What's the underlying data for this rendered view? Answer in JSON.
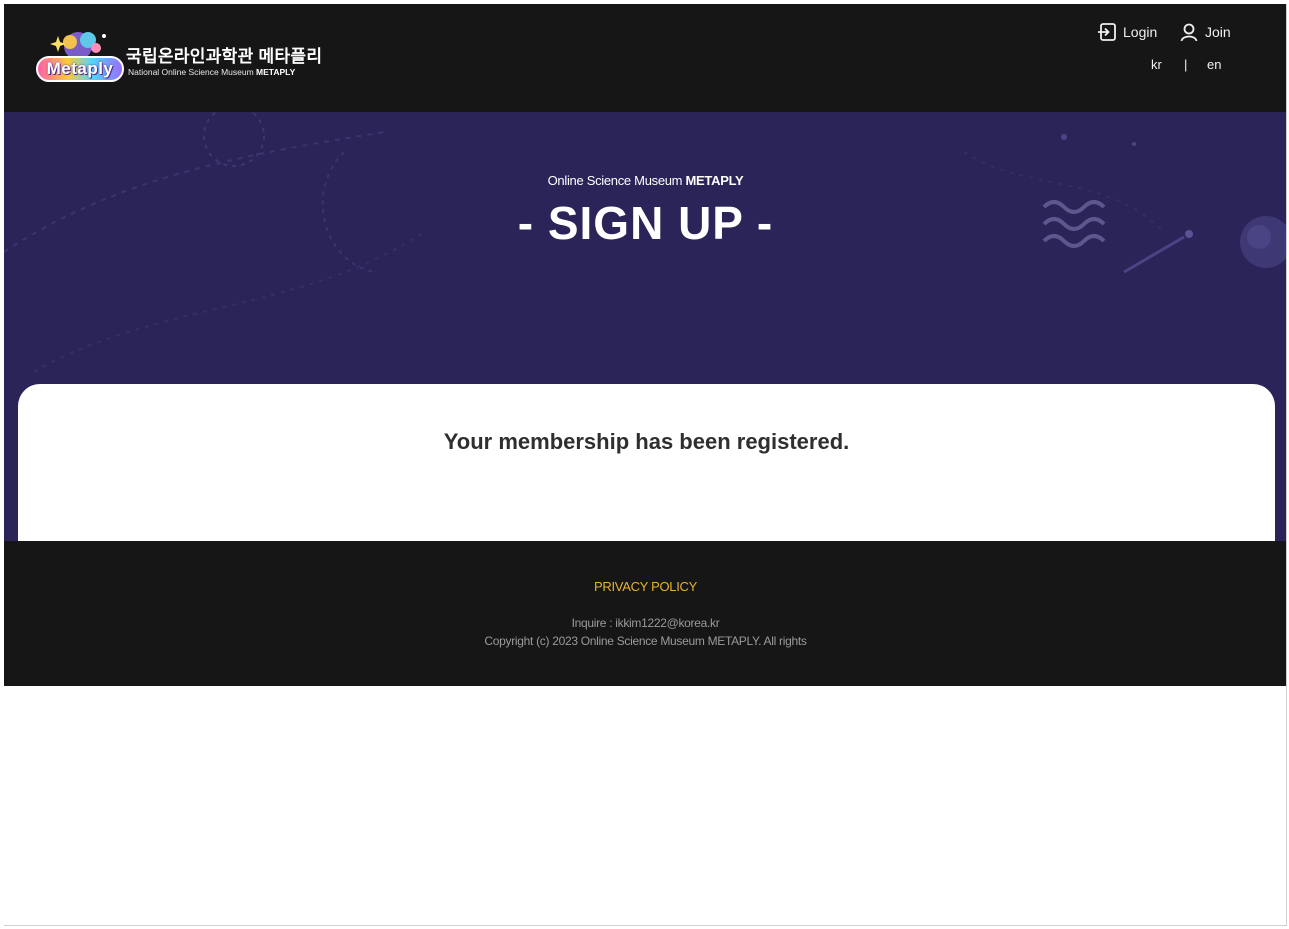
{
  "header": {
    "logo_badge": "Metaply",
    "site_title": "국립온라인과학관 메타플리",
    "site_subtitle_prefix": "National Online Science Museum ",
    "site_subtitle_brand": "METAPLY",
    "login_label": "Login",
    "join_label": "Join",
    "lang_kr": "kr",
    "lang_separator": "|",
    "lang_en": "en"
  },
  "hero": {
    "subtitle_prefix": "Online Science Museum ",
    "subtitle_brand": "METAPLY",
    "title": "- SIGN UP -"
  },
  "card": {
    "message": "Your membership has been registered."
  },
  "footer": {
    "privacy_label": "PRIVACY POLICY",
    "inquire": "Inquire : ikkim1222@korea.kr",
    "copyright": "Copyright (c) 2023 Online Science Museum METAPLY. All rights"
  },
  "colors": {
    "header_bg": "#171616",
    "hero_bg": "#2a2459",
    "privacy_link": "#e6b22d"
  }
}
